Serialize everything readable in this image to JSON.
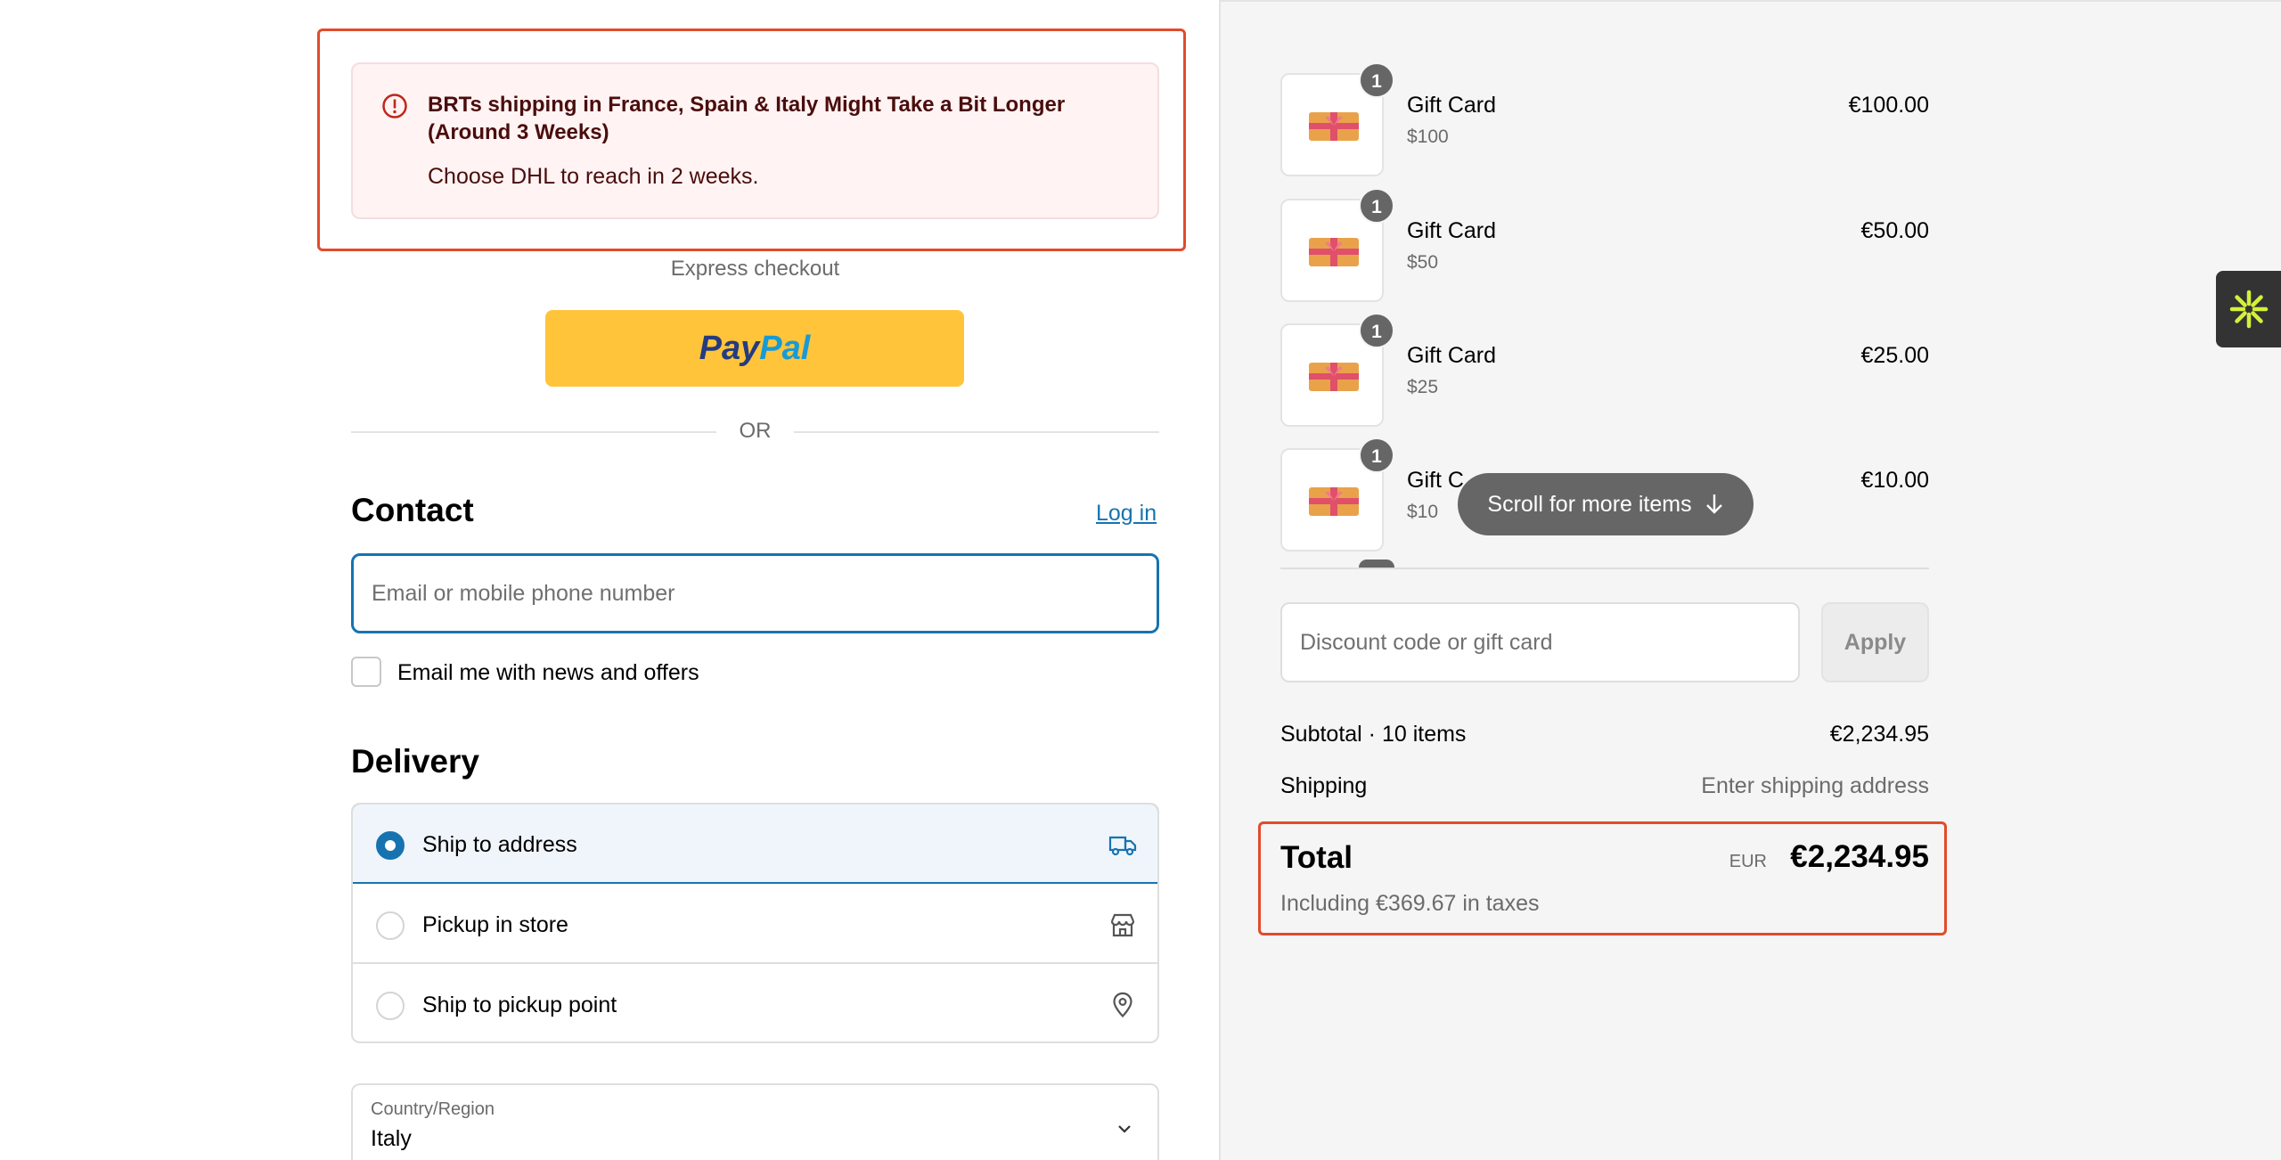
{
  "notice": {
    "title": "BRTs shipping in France, Spain & Italy Might Take a Bit Longer (Around 3 Weeks)",
    "body": "Choose DHL to reach in 2 weeks."
  },
  "express": {
    "label": "Express checkout",
    "paypal_pay": "Pay",
    "paypal_pal": "Pal",
    "or_text": "OR"
  },
  "contact": {
    "title": "Contact",
    "login_label": "Log in",
    "email_placeholder": "Email or mobile phone number",
    "newsletter_label": "Email me with news and offers"
  },
  "delivery": {
    "title": "Delivery",
    "options": [
      {
        "label": "Ship to address",
        "icon": "truck-icon",
        "selected": true
      },
      {
        "label": "Pickup in store",
        "icon": "store-icon",
        "selected": false
      },
      {
        "label": "Ship to pickup point",
        "icon": "location-pin-icon",
        "selected": false
      }
    ],
    "country_label": "Country/Region",
    "country_value": "Italy"
  },
  "cart": {
    "items": [
      {
        "name": "Gift Card",
        "variant": "$100",
        "price": "€100.00",
        "qty": "1"
      },
      {
        "name": "Gift Card",
        "variant": "$50",
        "price": "€50.00",
        "qty": "1"
      },
      {
        "name": "Gift Card",
        "variant": "$25",
        "price": "€25.00",
        "qty": "1"
      },
      {
        "name": "Gift C",
        "variant": "$10",
        "price": "€10.00",
        "qty": "1"
      }
    ],
    "scroll_hint": "Scroll for more items"
  },
  "discount": {
    "placeholder": "Discount code or gift card",
    "apply_label": "Apply"
  },
  "summary": {
    "subtotal_label": "Subtotal · 10 items",
    "subtotal_value": "€2,234.95",
    "shipping_label": "Shipping",
    "shipping_value": "Enter shipping address",
    "total_label": "Total",
    "currency": "EUR",
    "total_value": "€2,234.95",
    "tax_note": "Including €369.67 in taxes"
  },
  "colors": {
    "accent": "#1773b0",
    "highlight": "#e24b2b",
    "paypal": "#ffc439",
    "widget_icon": "#d4f03a"
  }
}
